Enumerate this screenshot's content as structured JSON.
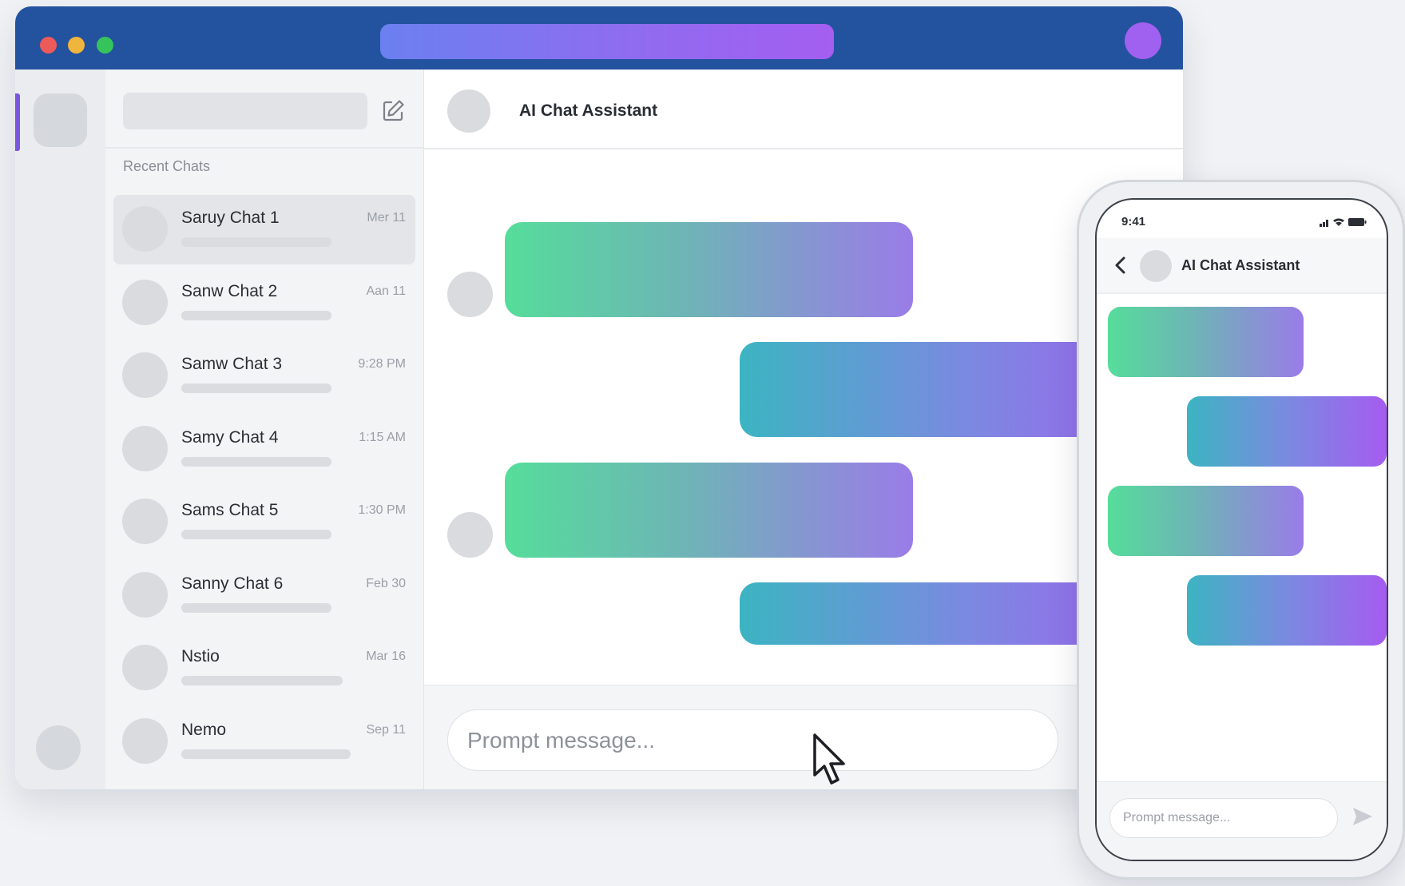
{
  "colors": {
    "titlebar": "#23529f",
    "close": "#ec5a5a",
    "minimize": "#f0b53c",
    "maximize": "#35c45c",
    "accent_purple": "#a060f0",
    "bot_bubble_gradient": [
      "#55dd9a",
      "#9a7ce8"
    ],
    "user_bubble_gradient": [
      "#3cb4c2",
      "#a55cf0"
    ]
  },
  "icons": {
    "compose": "compose-icon",
    "back": "chevron-left-icon",
    "send": "send-icon",
    "cursor": "mouse-pointer-icon",
    "signal": "signal-icon",
    "wifi": "wifi-icon",
    "battery": "battery-icon"
  },
  "sidebar": {
    "section_label": "Recent Chats",
    "chats": [
      {
        "name": "Saruy Chat 1",
        "time": "Mer 11",
        "active": true
      },
      {
        "name": "Sanw Chat 2",
        "time": "Aan 11"
      },
      {
        "name": "Samw Chat 3",
        "time": "9:28 PM"
      },
      {
        "name": "Samy Chat 4",
        "time": "1:15 AM"
      },
      {
        "name": "Sams Chat 5",
        "time": "1:30 PM"
      },
      {
        "name": "Sanny Chat 6",
        "time": "Feb 30"
      },
      {
        "name": "Nstio",
        "time": "Mar 16"
      },
      {
        "name": "Nemo",
        "time": "Sep 11"
      }
    ]
  },
  "chat": {
    "title": "AI Chat Assistant",
    "composer_placeholder": "Prompt message..."
  },
  "phone": {
    "status_time": "9:41",
    "title": "AI Chat Assistant",
    "composer_placeholder": "Prompt message..."
  }
}
